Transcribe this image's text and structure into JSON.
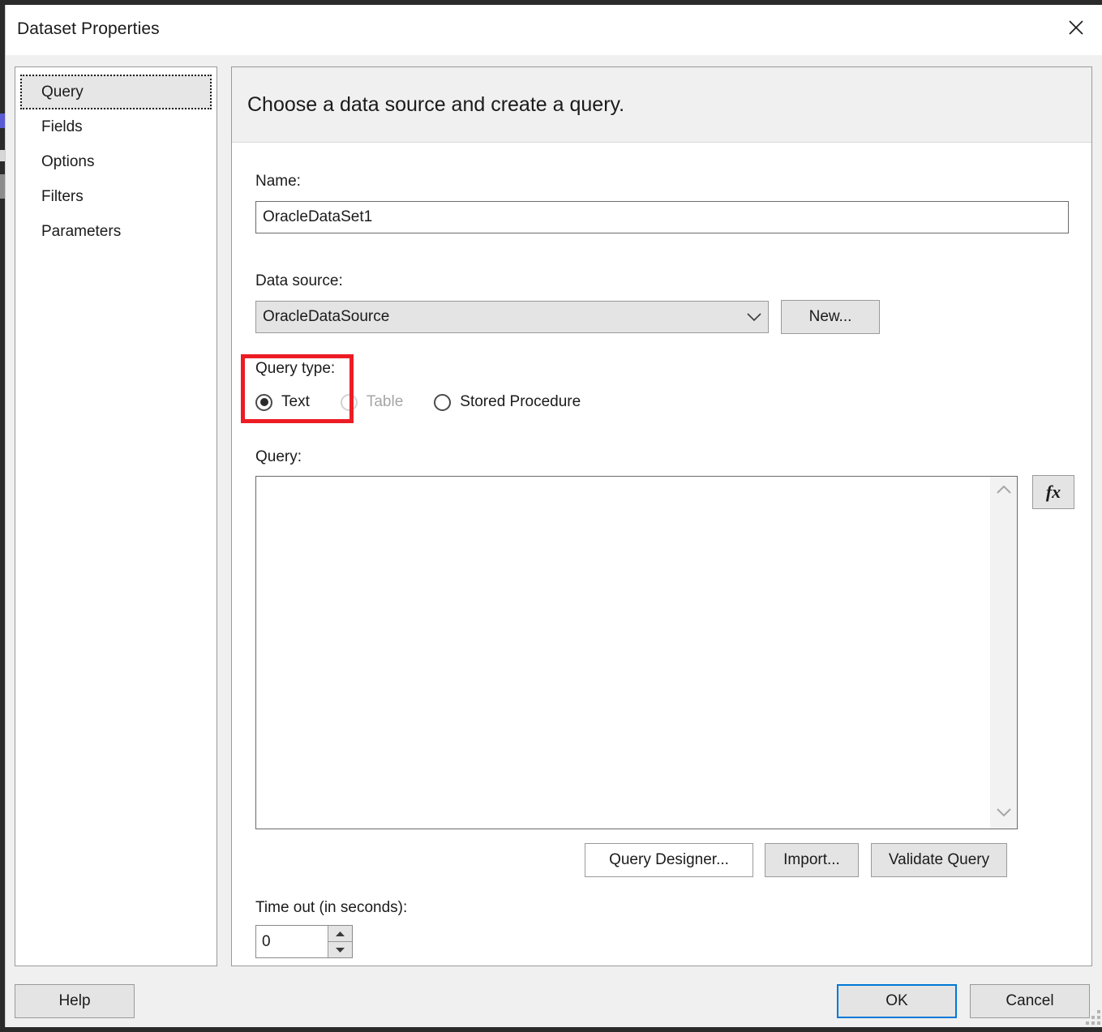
{
  "window": {
    "title": "Dataset Properties",
    "close_icon": "close-icon"
  },
  "sidebar": {
    "items": [
      {
        "label": "Query",
        "selected": true
      },
      {
        "label": "Fields",
        "selected": false
      },
      {
        "label": "Options",
        "selected": false
      },
      {
        "label": "Filters",
        "selected": false
      },
      {
        "label": "Parameters",
        "selected": false
      }
    ]
  },
  "content": {
    "header": "Choose a data source and create a query.",
    "name": {
      "label": "Name:",
      "value": "OracleDataSet1",
      "placeholder": ""
    },
    "data_source": {
      "label": "Data source:",
      "value": "OracleDataSource",
      "dropdown_icon": "chevron-down-icon",
      "new_button": "New..."
    },
    "query_type": {
      "label": "Query type:",
      "options": [
        {
          "label": "Text",
          "checked": true,
          "disabled": false
        },
        {
          "label": "Table",
          "checked": false,
          "disabled": true
        },
        {
          "label": "Stored Procedure",
          "checked": false,
          "disabled": false
        }
      ]
    },
    "query": {
      "label": "Query:",
      "value": "",
      "placeholder": "",
      "expression_button": "fx",
      "scroll_up_icon": "chevron-up-icon",
      "scroll_down_icon": "chevron-down-icon"
    },
    "query_buttons": [
      {
        "label": "Query Designer...",
        "default": true
      },
      {
        "label": "Import...",
        "default": false
      },
      {
        "label": "Validate Query",
        "default": false
      }
    ],
    "timeout": {
      "label": "Time out (in seconds):",
      "value": "0",
      "up_icon": "spinner-up-icon",
      "down_icon": "spinner-down-icon"
    }
  },
  "footer": {
    "help": "Help",
    "ok": "OK",
    "cancel": "Cancel",
    "resize_grip": "resize-grip-icon"
  },
  "annotation": {
    "color": "#ed1c24",
    "target": "query-type-group"
  }
}
